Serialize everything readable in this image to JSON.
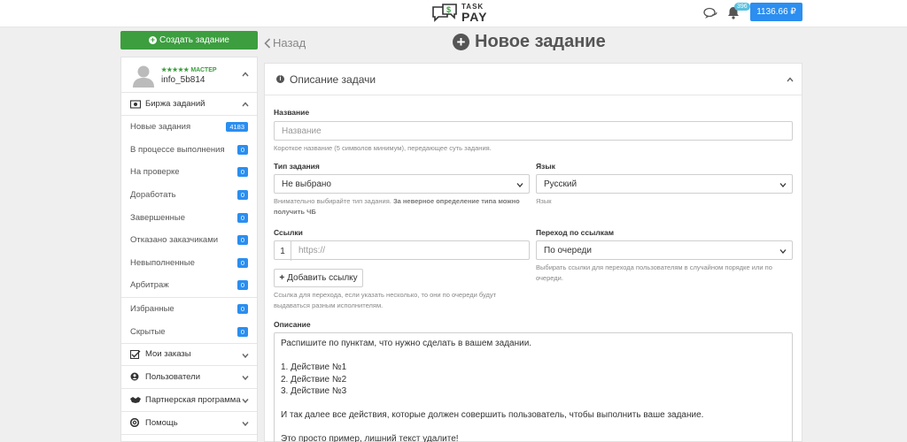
{
  "header": {
    "logo_top": "TASK",
    "logo_bottom": "PAY",
    "notifications_count": "396",
    "balance": "1136.66 ₽"
  },
  "sidebar": {
    "create_label": "Создать задание",
    "user": {
      "rank": "★★★★★ МАСТЕР",
      "name": "info_5b814"
    },
    "exchange_label": "Биржа заданий",
    "tasks": [
      {
        "label": "Новые задания",
        "count": "4183"
      },
      {
        "label": "В процессе выполнения",
        "count": "0"
      },
      {
        "label": "На проверке",
        "count": "0"
      },
      {
        "label": "Доработать",
        "count": "0"
      },
      {
        "label": "Завершенные",
        "count": "0"
      },
      {
        "label": "Отказано заказчиками",
        "count": "0"
      },
      {
        "label": "Невыполненные",
        "count": "0"
      },
      {
        "label": "Арбитраж",
        "count": "0"
      }
    ],
    "extra": [
      {
        "label": "Избранные",
        "count": "0"
      },
      {
        "label": "Скрытые",
        "count": "0"
      }
    ],
    "sections": [
      "Мои заказы",
      "Пользователи",
      "Партнерская программа",
      "Помощь"
    ]
  },
  "main": {
    "back_label": "Назад",
    "title": "Новое задание",
    "panel_title": "Описание задачи",
    "name_label": "Название",
    "name_placeholder": "Название",
    "name_help": "Короткое название (5 символов минимум), передающее суть задания.",
    "type_label": "Тип задания",
    "type_value": "Не выбрано",
    "type_help_plain": "Внимательно выбирайте тип задания. ",
    "type_help_bold": "За неверное определение типа можно получить ЧБ",
    "lang_label": "Язык",
    "lang_value": "Русский",
    "lang_help": "Язык",
    "links_label": "Ссылки",
    "link_number": "1",
    "link_placeholder": "https://",
    "add_link_label": "Добавить ссылку",
    "links_help": "Ссылка для перехода, если указать несколько, то они по очереди будут выдаваться разным исполнителям.",
    "transition_label": "Переход по ссылкам",
    "transition_value": "По очереди",
    "transition_help": "Выбирать ссылки для перехода пользователям в случайном порядке или по очереди.",
    "desc_label": "Описание",
    "desc_text": "Распишите по пунктам, что нужно сделать в вашем задании.\n\n1. Действие №1\n2. Действие №2\n3. Действие №3\n\nИ так далее все действия, которые должен совершить пользователь, чтобы выполнить ваше задание.\n\nЭто просто пример, лишний текст удалите!"
  }
}
